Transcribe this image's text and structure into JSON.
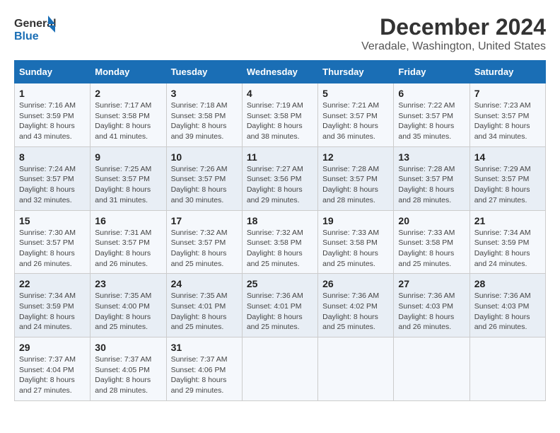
{
  "logo": {
    "text_general": "General",
    "text_blue": "Blue"
  },
  "title": "December 2024",
  "subtitle": "Veradale, Washington, United States",
  "days_of_week": [
    "Sunday",
    "Monday",
    "Tuesday",
    "Wednesday",
    "Thursday",
    "Friday",
    "Saturday"
  ],
  "weeks": [
    [
      {
        "day": "1",
        "sunrise": "Sunrise: 7:16 AM",
        "sunset": "Sunset: 3:59 PM",
        "daylight": "Daylight: 8 hours and 43 minutes."
      },
      {
        "day": "2",
        "sunrise": "Sunrise: 7:17 AM",
        "sunset": "Sunset: 3:58 PM",
        "daylight": "Daylight: 8 hours and 41 minutes."
      },
      {
        "day": "3",
        "sunrise": "Sunrise: 7:18 AM",
        "sunset": "Sunset: 3:58 PM",
        "daylight": "Daylight: 8 hours and 39 minutes."
      },
      {
        "day": "4",
        "sunrise": "Sunrise: 7:19 AM",
        "sunset": "Sunset: 3:58 PM",
        "daylight": "Daylight: 8 hours and 38 minutes."
      },
      {
        "day": "5",
        "sunrise": "Sunrise: 7:21 AM",
        "sunset": "Sunset: 3:57 PM",
        "daylight": "Daylight: 8 hours and 36 minutes."
      },
      {
        "day": "6",
        "sunrise": "Sunrise: 7:22 AM",
        "sunset": "Sunset: 3:57 PM",
        "daylight": "Daylight: 8 hours and 35 minutes."
      },
      {
        "day": "7",
        "sunrise": "Sunrise: 7:23 AM",
        "sunset": "Sunset: 3:57 PM",
        "daylight": "Daylight: 8 hours and 34 minutes."
      }
    ],
    [
      {
        "day": "8",
        "sunrise": "Sunrise: 7:24 AM",
        "sunset": "Sunset: 3:57 PM",
        "daylight": "Daylight: 8 hours and 32 minutes."
      },
      {
        "day": "9",
        "sunrise": "Sunrise: 7:25 AM",
        "sunset": "Sunset: 3:57 PM",
        "daylight": "Daylight: 8 hours and 31 minutes."
      },
      {
        "day": "10",
        "sunrise": "Sunrise: 7:26 AM",
        "sunset": "Sunset: 3:57 PM",
        "daylight": "Daylight: 8 hours and 30 minutes."
      },
      {
        "day": "11",
        "sunrise": "Sunrise: 7:27 AM",
        "sunset": "Sunset: 3:56 PM",
        "daylight": "Daylight: 8 hours and 29 minutes."
      },
      {
        "day": "12",
        "sunrise": "Sunrise: 7:28 AM",
        "sunset": "Sunset: 3:57 PM",
        "daylight": "Daylight: 8 hours and 28 minutes."
      },
      {
        "day": "13",
        "sunrise": "Sunrise: 7:28 AM",
        "sunset": "Sunset: 3:57 PM",
        "daylight": "Daylight: 8 hours and 28 minutes."
      },
      {
        "day": "14",
        "sunrise": "Sunrise: 7:29 AM",
        "sunset": "Sunset: 3:57 PM",
        "daylight": "Daylight: 8 hours and 27 minutes."
      }
    ],
    [
      {
        "day": "15",
        "sunrise": "Sunrise: 7:30 AM",
        "sunset": "Sunset: 3:57 PM",
        "daylight": "Daylight: 8 hours and 26 minutes."
      },
      {
        "day": "16",
        "sunrise": "Sunrise: 7:31 AM",
        "sunset": "Sunset: 3:57 PM",
        "daylight": "Daylight: 8 hours and 26 minutes."
      },
      {
        "day": "17",
        "sunrise": "Sunrise: 7:32 AM",
        "sunset": "Sunset: 3:57 PM",
        "daylight": "Daylight: 8 hours and 25 minutes."
      },
      {
        "day": "18",
        "sunrise": "Sunrise: 7:32 AM",
        "sunset": "Sunset: 3:58 PM",
        "daylight": "Daylight: 8 hours and 25 minutes."
      },
      {
        "day": "19",
        "sunrise": "Sunrise: 7:33 AM",
        "sunset": "Sunset: 3:58 PM",
        "daylight": "Daylight: 8 hours and 25 minutes."
      },
      {
        "day": "20",
        "sunrise": "Sunrise: 7:33 AM",
        "sunset": "Sunset: 3:58 PM",
        "daylight": "Daylight: 8 hours and 25 minutes."
      },
      {
        "day": "21",
        "sunrise": "Sunrise: 7:34 AM",
        "sunset": "Sunset: 3:59 PM",
        "daylight": "Daylight: 8 hours and 24 minutes."
      }
    ],
    [
      {
        "day": "22",
        "sunrise": "Sunrise: 7:34 AM",
        "sunset": "Sunset: 3:59 PM",
        "daylight": "Daylight: 8 hours and 24 minutes."
      },
      {
        "day": "23",
        "sunrise": "Sunrise: 7:35 AM",
        "sunset": "Sunset: 4:00 PM",
        "daylight": "Daylight: 8 hours and 25 minutes."
      },
      {
        "day": "24",
        "sunrise": "Sunrise: 7:35 AM",
        "sunset": "Sunset: 4:01 PM",
        "daylight": "Daylight: 8 hours and 25 minutes."
      },
      {
        "day": "25",
        "sunrise": "Sunrise: 7:36 AM",
        "sunset": "Sunset: 4:01 PM",
        "daylight": "Daylight: 8 hours and 25 minutes."
      },
      {
        "day": "26",
        "sunrise": "Sunrise: 7:36 AM",
        "sunset": "Sunset: 4:02 PM",
        "daylight": "Daylight: 8 hours and 25 minutes."
      },
      {
        "day": "27",
        "sunrise": "Sunrise: 7:36 AM",
        "sunset": "Sunset: 4:03 PM",
        "daylight": "Daylight: 8 hours and 26 minutes."
      },
      {
        "day": "28",
        "sunrise": "Sunrise: 7:36 AM",
        "sunset": "Sunset: 4:03 PM",
        "daylight": "Daylight: 8 hours and 26 minutes."
      }
    ],
    [
      {
        "day": "29",
        "sunrise": "Sunrise: 7:37 AM",
        "sunset": "Sunset: 4:04 PM",
        "daylight": "Daylight: 8 hours and 27 minutes."
      },
      {
        "day": "30",
        "sunrise": "Sunrise: 7:37 AM",
        "sunset": "Sunset: 4:05 PM",
        "daylight": "Daylight: 8 hours and 28 minutes."
      },
      {
        "day": "31",
        "sunrise": "Sunrise: 7:37 AM",
        "sunset": "Sunset: 4:06 PM",
        "daylight": "Daylight: 8 hours and 29 minutes."
      },
      null,
      null,
      null,
      null
    ]
  ]
}
